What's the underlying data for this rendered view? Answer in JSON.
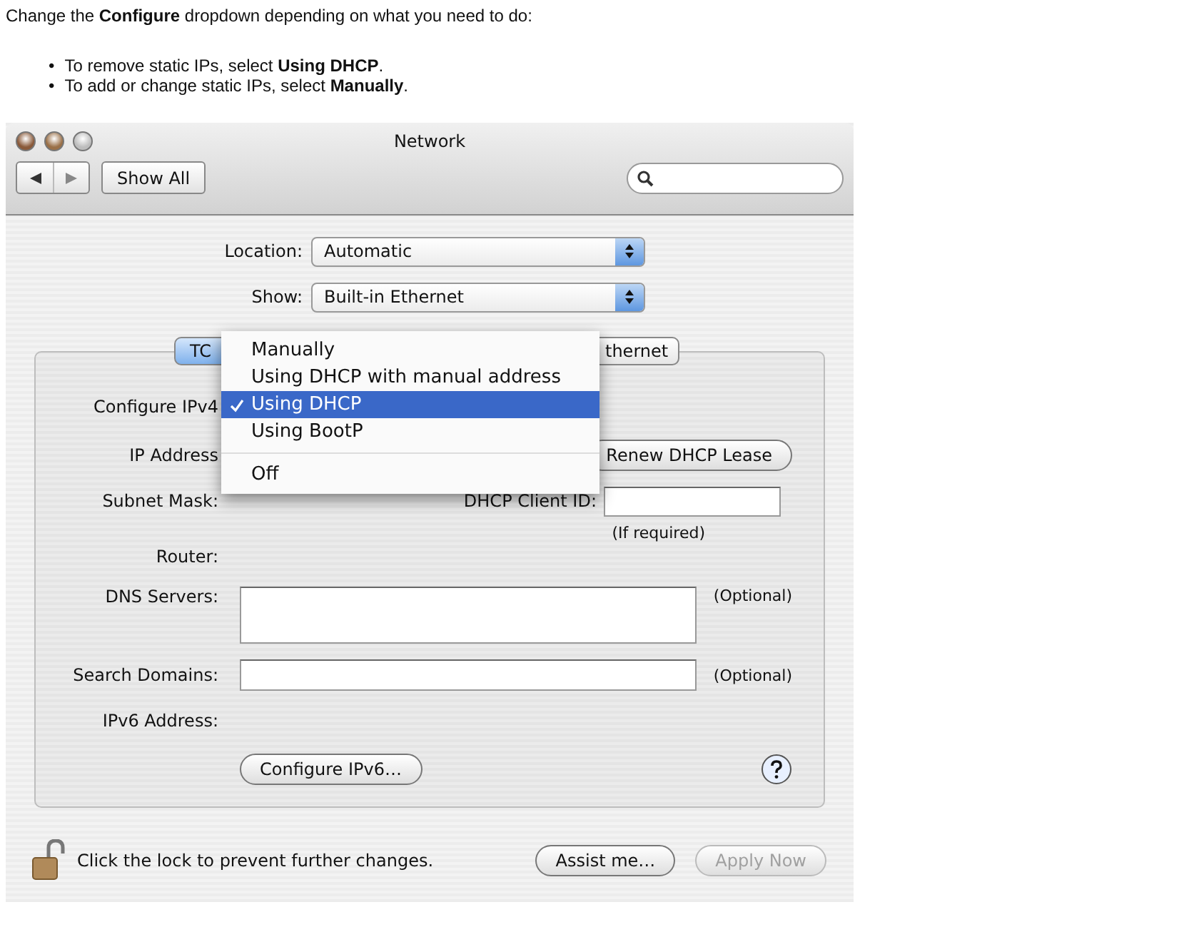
{
  "intro": {
    "text": "Change the **Configure** dropdown depending on what you need to do:",
    "marker": "•",
    "bullets": [
      "To remove static IPs, select **Using DHCP**.",
      "To add or change static IPs, select **Manually**."
    ]
  },
  "window": {
    "title": "Network"
  },
  "toolbar": {
    "show_all": "Show All"
  },
  "location": {
    "label": "Location:",
    "value": "Automatic"
  },
  "show": {
    "label": "Show:",
    "value": "Built-in Ethernet"
  },
  "tabs": [
    {
      "label": "TC",
      "selected": true
    },
    {
      "label": "thernet",
      "selected": false
    }
  ],
  "tcpip": {
    "configure_label": "Configure IPv4",
    "ip_label": "IP Address",
    "renew_button": "Renew DHCP Lease",
    "subnet_label": "Subnet Mask:",
    "client_id_label": "DHCP Client ID:",
    "client_id_hint": "(If required)",
    "router_label": "Router:",
    "dns_label": "DNS Servers:",
    "dns_hint": "(Optional)",
    "search_label": "Search Domains:",
    "search_hint": "(Optional)",
    "ipv6_label": "IPv6 Address:",
    "ipv6_button": "Configure IPv6…"
  },
  "menu": {
    "items": [
      {
        "kind": "item",
        "label": "Manually",
        "selected": false
      },
      {
        "kind": "item",
        "label": "Using DHCP with manual address",
        "selected": false
      },
      {
        "kind": "item",
        "label": "Using DHCP",
        "selected": true
      },
      {
        "kind": "item",
        "label": "Using BootP",
        "selected": false
      },
      {
        "kind": "separator"
      },
      {
        "kind": "item",
        "label": "Off",
        "selected": false
      }
    ]
  },
  "footer": {
    "lock_text": "Click the lock to prevent further changes.",
    "buttons": [
      {
        "label": "Assist me…",
        "disabled": false
      },
      {
        "label": "Apply Now",
        "disabled": true
      }
    ]
  }
}
